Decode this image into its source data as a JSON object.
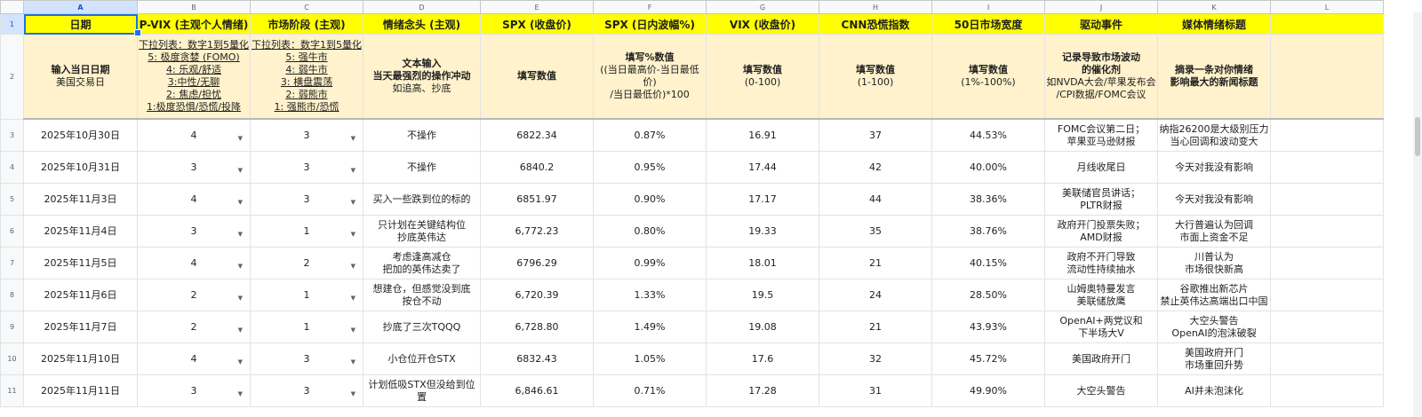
{
  "columns": [
    "A",
    "B",
    "C",
    "D",
    "E",
    "F",
    "G",
    "H",
    "I",
    "J",
    "K",
    "L"
  ],
  "rows": [
    "1",
    "2",
    "3",
    "4",
    "5",
    "6",
    "7",
    "8",
    "9",
    "10",
    "11"
  ],
  "header": [
    "日期",
    "P-VIX (主观个人情绪)",
    "市场阶段 (主观)",
    "情绪念头 (主观)",
    "SPX (收盘价)",
    "SPX (日内波幅%)",
    "VIX (收盘价)",
    "CNN恐慌指数",
    "50日市场宽度",
    "驱动事件",
    "媒体情绪标题"
  ],
  "desc": {
    "a": {
      "b": "输入当日日期",
      "n": "美国交易日"
    },
    "b": {
      "u1": "下拉列表：数字1到5量化",
      "u2": "5: 极度贪婪 (FOMO)",
      "u3": "4: 乐观/舒适",
      "u4": "3:中性/无聊",
      "u5": "2: 焦虑/担忧",
      "u6": "1:极度恐惧/恐慌/投降"
    },
    "c": {
      "u1": "下拉列表：数字1到5量化",
      "u2": "5: 强牛市",
      "u3": "4: 弱牛市",
      "u4": "3: 横盘震荡",
      "u5": "2: 弱熊市",
      "u6": "1: 强熊市/恐慌"
    },
    "d": {
      "b1": "文本输入",
      "b2": "当天最强烈的操作冲动",
      "n": "如追高、抄底"
    },
    "e": {
      "b": "填写数值"
    },
    "f": {
      "b": "填写%数值",
      "n1": "((当日最高价-当日最低价)",
      "n2": "/当日最低价)*100"
    },
    "g": {
      "b": "填写数值",
      "n": "(0-100)"
    },
    "h": {
      "b": "填写数值",
      "n": "(1-100)"
    },
    "i": {
      "b": "填写数值",
      "n": "(1%-100%)"
    },
    "j": {
      "b1": "记录导致市场波动",
      "b2": "的催化剂",
      "n1": "如NVDA大会/苹果发布会",
      "n2": "/CPI数据/FOMC会议"
    },
    "k": {
      "b1": "摘录一条对你情绪",
      "b2": "影响最大的新闻标题"
    }
  },
  "data": [
    {
      "date": "2025年10月30日",
      "pvix": "4",
      "stage": "3",
      "thought": "不操作",
      "spx": "6822.34",
      "range": "0.87%",
      "vix": "16.91",
      "cnn": "37",
      "breadth": "44.53%",
      "event": "FOMC会议第二日；\n苹果亚马逊财报",
      "media": "纳指26200是大级别压力\n当心回调和波动变大"
    },
    {
      "date": "2025年10月31日",
      "pvix": "3",
      "stage": "3",
      "thought": "不操作",
      "spx": "6840.2",
      "range": "0.95%",
      "vix": "17.44",
      "cnn": "42",
      "breadth": "40.00%",
      "event": "月线收尾日",
      "media": "今天对我没有影响"
    },
    {
      "date": "2025年11月3日",
      "pvix": "4",
      "stage": "3",
      "thought": "买入一些跌到位的标的",
      "spx": "6851.97",
      "range": "0.90%",
      "vix": "17.17",
      "cnn": "44",
      "breadth": "38.36%",
      "event": "美联储官员讲话；\nPLTR财报",
      "media": "今天对我没有影响"
    },
    {
      "date": "2025年11月4日",
      "pvix": "3",
      "stage": "1",
      "thought": "只计划在关键结构位\n抄底英伟达",
      "spx": "6,772.23",
      "range": "0.80%",
      "vix": "19.33",
      "cnn": "35",
      "breadth": "38.76%",
      "event": "政府开门投票失败；\nAMD财报",
      "media": "大行普遍认为回调\n市面上资金不足"
    },
    {
      "date": "2025年11月5日",
      "pvix": "4",
      "stage": "2",
      "thought": "考虑逢高减仓\n把加的英伟达卖了",
      "spx": "6796.29",
      "range": "0.99%",
      "vix": "18.01",
      "cnn": "21",
      "breadth": "40.15%",
      "event": "政府不开门导致\n流动性持续抽水",
      "media": "川普认为\n市场很快新高"
    },
    {
      "date": "2025年11月6日",
      "pvix": "2",
      "stage": "1",
      "thought": "想建仓，但感觉没到底\n按仓不动",
      "spx": "6,720.39",
      "range": "1.33%",
      "vix": "19.5",
      "cnn": "24",
      "breadth": "28.50%",
      "event": "山姆奥特曼发言\n美联储放鹰",
      "media": "谷歌推出新芯片\n禁止英伟达高端出口中国"
    },
    {
      "date": "2025年11月7日",
      "pvix": "2",
      "stage": "1",
      "thought": "抄底了三次TQQQ",
      "spx": "6,728.80",
      "range": "1.49%",
      "vix": "19.08",
      "cnn": "21",
      "breadth": "43.93%",
      "event": "OpenAI+两党议和\n下半场大V",
      "media": "大空头警告\nOpenAI的泡沫破裂"
    },
    {
      "date": "2025年11月10日",
      "pvix": "4",
      "stage": "3",
      "thought": "小仓位开仓STX",
      "spx": "6832.43",
      "range": "1.05%",
      "vix": "17.6",
      "cnn": "32",
      "breadth": "45.72%",
      "event": "美国政府开门",
      "media": "美国政府开门\n市场重回升势"
    },
    {
      "date": "2025年11月11日",
      "pvix": "3",
      "stage": "3",
      "thought": "计划低吸STX但没给到位置",
      "spx": "6,846.61",
      "range": "0.71%",
      "vix": "17.28",
      "cnn": "31",
      "breadth": "49.90%",
      "event": "大空头警告",
      "media": "AI并未泡沫化"
    }
  ]
}
